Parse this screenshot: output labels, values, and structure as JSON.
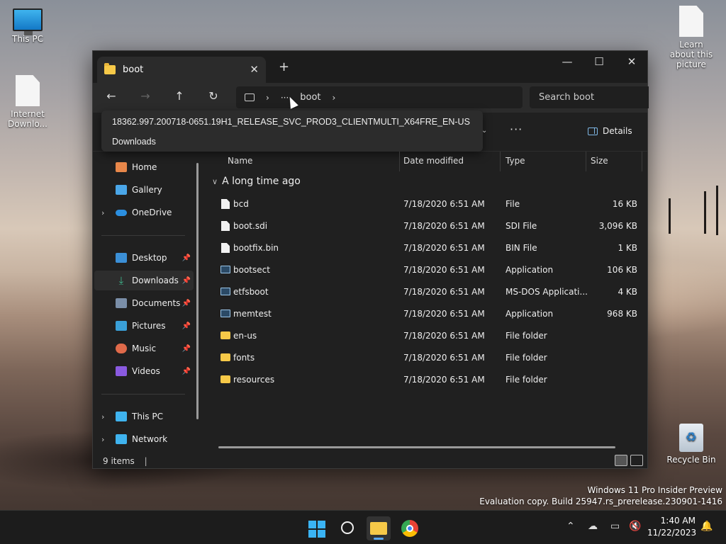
{
  "desktop": {
    "icons": [
      {
        "label": "This PC"
      },
      {
        "label": "Internet Downlo..."
      },
      {
        "label": "Learn about this picture"
      },
      {
        "label": "Recycle Bin"
      }
    ],
    "watermark": {
      "line1": "Windows 11 Pro Insider Preview",
      "line2": "Evaluation copy. Build 25947.rs_prerelease.230901-1416"
    }
  },
  "window": {
    "tab_title": "boot",
    "tab_close": "✕",
    "new_tab": "+",
    "controls": {
      "minimize": "—",
      "maximize": "☐",
      "close": "✕"
    },
    "nav": {
      "back": "←",
      "forward": "→",
      "up": "↑",
      "refresh": "↻"
    },
    "address": {
      "more": "···",
      "crumb": "boot",
      "sep": "›"
    },
    "search_placeholder": "Search boot",
    "flyout": {
      "item1": "18362.997.200718-0651.19H1_RELEASE_SVC_PROD3_CLIENTMULTI_X64FRE_EN-US",
      "item2": "Downloads"
    },
    "toolbar": {
      "more": "···",
      "details": "Details"
    },
    "sidebar": [
      {
        "label": "Home",
        "color": "#e8874a"
      },
      {
        "label": "Gallery",
        "color": "#4aa6e8"
      },
      {
        "label": "OneDrive",
        "color": "#2b8fe0"
      },
      {
        "label": "Desktop",
        "color": "#3b8fd6"
      },
      {
        "label": "Downloads",
        "color": "#3fb68b"
      },
      {
        "label": "Documents",
        "color": "#7a8ea8"
      },
      {
        "label": "Pictures",
        "color": "#3aa0d8"
      },
      {
        "label": "Music",
        "color": "#e06a4a"
      },
      {
        "label": "Videos",
        "color": "#8a5ae0"
      },
      {
        "label": "This PC",
        "color": "#3fb3ee"
      },
      {
        "label": "Network",
        "color": "#3fb3ee"
      }
    ],
    "columns": {
      "name": "Name",
      "date": "Date modified",
      "type": "Type",
      "size": "Size"
    },
    "group_label": "A long time ago",
    "files": [
      {
        "name": "bcd",
        "date": "7/18/2020 6:51 AM",
        "type": "File",
        "size": "16 KB",
        "icon": "file"
      },
      {
        "name": "boot.sdi",
        "date": "7/18/2020 6:51 AM",
        "type": "SDI File",
        "size": "3,096 KB",
        "icon": "file"
      },
      {
        "name": "bootfix.bin",
        "date": "7/18/2020 6:51 AM",
        "type": "BIN File",
        "size": "1 KB",
        "icon": "file"
      },
      {
        "name": "bootsect",
        "date": "7/18/2020 6:51 AM",
        "type": "Application",
        "size": "106 KB",
        "icon": "app"
      },
      {
        "name": "etfsboot",
        "date": "7/18/2020 6:51 AM",
        "type": "MS-DOS Applicati...",
        "size": "4 KB",
        "icon": "app"
      },
      {
        "name": "memtest",
        "date": "7/18/2020 6:51 AM",
        "type": "Application",
        "size": "968 KB",
        "icon": "app"
      },
      {
        "name": "en-us",
        "date": "7/18/2020 6:51 AM",
        "type": "File folder",
        "size": "",
        "icon": "fold"
      },
      {
        "name": "fonts",
        "date": "7/18/2020 6:51 AM",
        "type": "File folder",
        "size": "",
        "icon": "fold"
      },
      {
        "name": "resources",
        "date": "7/18/2020 6:51 AM",
        "type": "File folder",
        "size": "",
        "icon": "fold"
      }
    ],
    "status": "9 items"
  },
  "taskbar": {
    "time": "1:40 AM",
    "date": "11/22/2023"
  }
}
